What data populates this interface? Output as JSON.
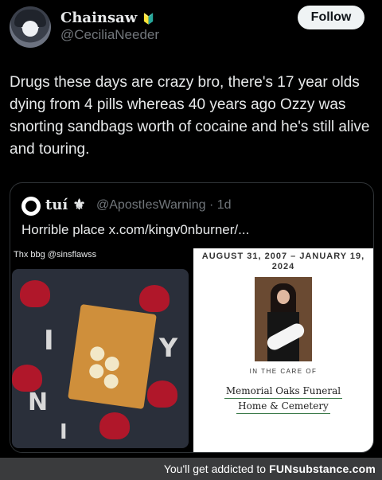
{
  "post": {
    "author_name": "Chainsaw",
    "author_badge": "🔰",
    "author_handle": "@CeciliaNeeder",
    "follow_label": "Follow",
    "text": "Drugs these days are crazy bro, there's 17 year olds dying from 4 pills whereas 40 years ago Ozzy was snorting sandbags worth of cocaine and he's still alive and touring."
  },
  "quote": {
    "author_name": "tuí ⚜",
    "author_handle": "@ApostIesWarning",
    "time": "· 1d",
    "text": "Horrible place x.com/kingv0nburner/...",
    "left_image_caption": "Thx bbg @sinsflawss",
    "obituary": {
      "dates": "AUGUST 31, 2007 – JANUARY 19, 2024",
      "care_label": "IN THE CARE OF",
      "home_line1": "Memorial Oaks Funeral",
      "home_line2": "Home & Cemetery"
    }
  },
  "footer": {
    "text": "You'll get addicted to",
    "brand": "FUNsubstance.com"
  }
}
